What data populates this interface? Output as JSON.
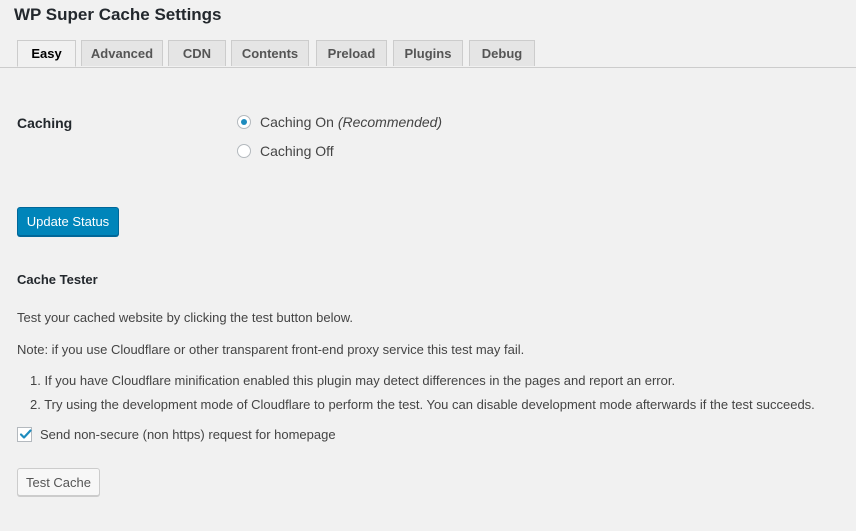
{
  "page_title": "WP Super Cache Settings",
  "tabs": [
    {
      "label": "Easy",
      "active": true
    },
    {
      "label": "Advanced",
      "active": false
    },
    {
      "label": "CDN",
      "active": false
    },
    {
      "label": "Contents",
      "active": false
    },
    {
      "label": "Preload",
      "active": false
    },
    {
      "label": "Plugins",
      "active": false
    },
    {
      "label": "Debug",
      "active": false
    }
  ],
  "caching": {
    "label": "Caching",
    "options": [
      {
        "label": "Caching On",
        "note": "(Recommended)",
        "checked": true
      },
      {
        "label": "Caching Off",
        "note": "",
        "checked": false
      }
    ]
  },
  "update_button": "Update Status",
  "cache_tester": {
    "heading": "Cache Tester",
    "intro": "Test your cached website by clicking the test button below.",
    "note": "Note: if you use Cloudflare or other transparent front-end proxy service this test may fail.",
    "items": [
      "1. If you have Cloudflare minification enabled this plugin may detect differences in the pages and report an error.",
      "2. Try using the development mode of Cloudflare to perform the test. You can disable development mode afterwards if the test succeeds."
    ],
    "checkbox": {
      "label": "Send non-secure (non https) request for homepage",
      "checked": true
    },
    "test_button": "Test Cache"
  },
  "colors": {
    "primary": "#0085ba",
    "background": "#f1f1f1",
    "radio_dot": "#1e8cbe"
  }
}
